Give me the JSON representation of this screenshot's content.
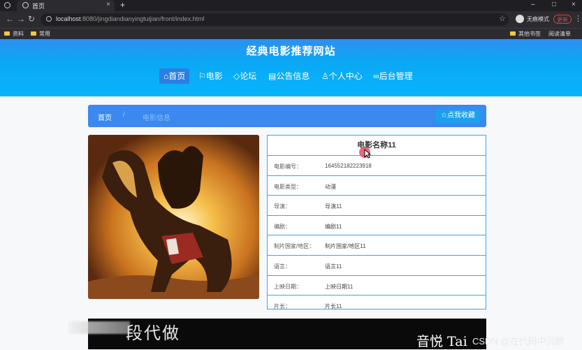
{
  "browser": {
    "tab_title": "首页",
    "new_tab": "+",
    "url_host": "localhost",
    "url_path": ":8080/jingdiandianyingtuijian/front/index.html",
    "incognito_label": "无痕模式",
    "update_label": "更新",
    "bookmarks": [
      "资料",
      "常用"
    ],
    "bookmarks_right": [
      "其他书签",
      "阅读清单"
    ]
  },
  "site": {
    "title": "经典电影推荐网站",
    "nav": [
      {
        "label": "首页",
        "icon": "home-icon",
        "active": true
      },
      {
        "label": "电影",
        "icon": "flag-icon"
      },
      {
        "label": "论坛",
        "icon": "tag-icon"
      },
      {
        "label": "公告信息",
        "icon": "notice-icon"
      },
      {
        "label": "个人中心",
        "icon": "user-icon"
      },
      {
        "label": "后台管理",
        "icon": "link-icon"
      }
    ],
    "breadcrumb": {
      "home": "首页",
      "separator": "/",
      "current": "电影信息"
    },
    "favorite_button": "☆点我收藏"
  },
  "movie": {
    "name": "电影名称11",
    "fields": [
      {
        "key": "电影编号：",
        "value": "1645521822239​18"
      },
      {
        "key": "电影类型：",
        "value": "动漫"
      },
      {
        "key": "导演：",
        "value": "导演11"
      },
      {
        "key": "编剧：",
        "value": "编剧11"
      },
      {
        "key": "制片国家/地区：",
        "value": "制片国家/地区11"
      },
      {
        "key": "语言：",
        "value": "语言11"
      },
      {
        "key": "上映日期：",
        "value": "上映日期11"
      },
      {
        "key": "片长：",
        "value": "片长11"
      }
    ]
  },
  "overlay": {
    "video_text": "段代做",
    "signature": "音悦 Tai",
    "watermark": "CSDN @在代码中沉醉"
  },
  "colors": {
    "header_blue": "#08b4fb",
    "crumb_blue": "#3a88f0",
    "border_blue": "#37a6ee"
  }
}
